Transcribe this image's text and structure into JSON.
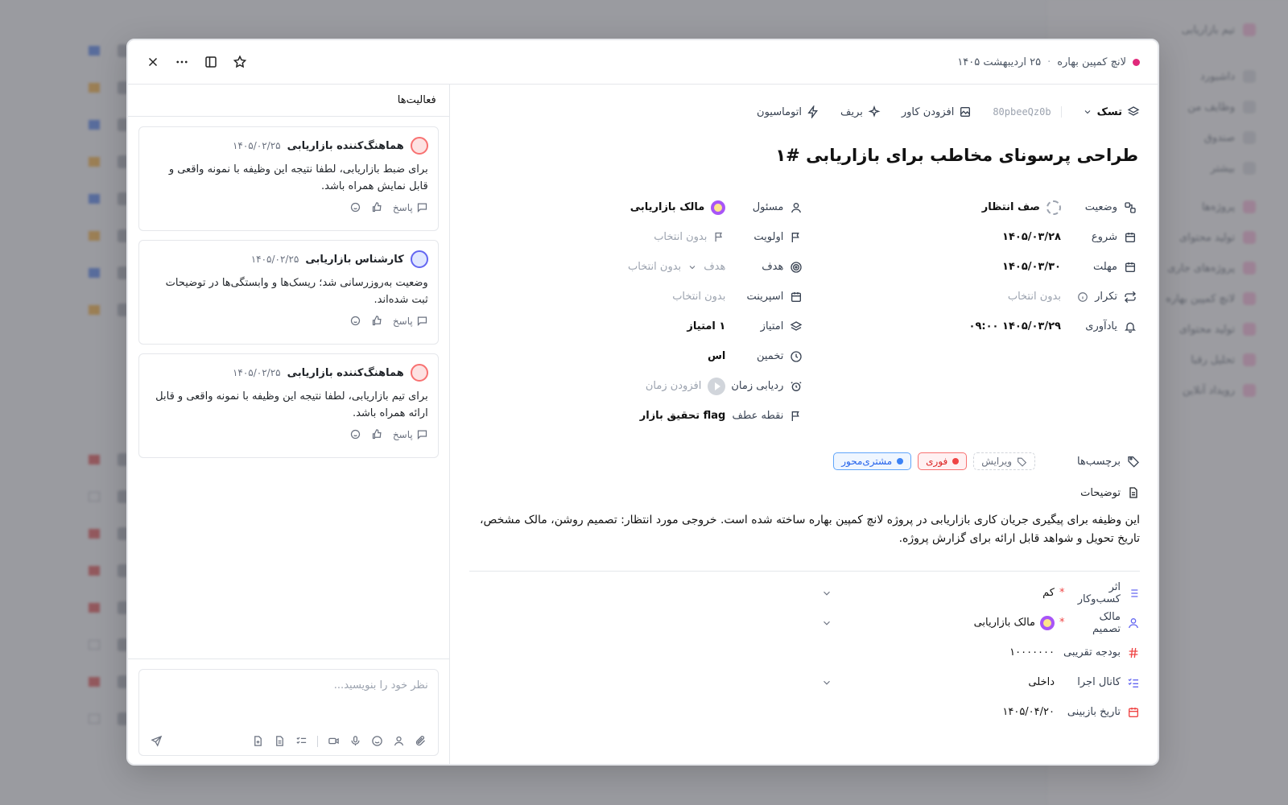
{
  "background": {
    "sidebar_items": [
      "تیم بازاریابی",
      "داشبورد",
      "وظایف من",
      "صندوق",
      "بیشتر",
      "پروژه‌ها",
      "تولید محتوای",
      "پروژه‌های جاری",
      "لانچ کمپین بهاره",
      "تولید محتوای",
      "تحلیل رقبا",
      "رویداد آنلاین"
    ]
  },
  "header": {
    "project": "لانچ کمپین بهاره",
    "date": "۲۵ اردیبهشت ۱۴۰۵"
  },
  "toolbar": {
    "type": "تسک",
    "id": "80pbeeQz0b",
    "add_cover": "افزودن کاور",
    "brief": "بریف",
    "automation": "اتوماسیون"
  },
  "task": {
    "title": "طراحی پرسونای مخاطب برای بازاریابی #۱"
  },
  "properties": {
    "status": {
      "label": "وضعیت",
      "value": "صف انتظار"
    },
    "start": {
      "label": "شروع",
      "value": "۱۴۰۵/۰۳/۲۸"
    },
    "due": {
      "label": "مهلت",
      "value": "۱۴۰۵/۰۳/۳۰"
    },
    "repeat": {
      "label": "تکرار",
      "value": "بدون انتخاب"
    },
    "reminder": {
      "label": "یادآوری",
      "value": "۱۴۰۵/۰۳/۲۹ ۰۹:۰۰"
    },
    "assignee": {
      "label": "مسئول",
      "value": "مالک بازاریابی"
    },
    "priority": {
      "label": "اولویت",
      "value": "بدون انتخاب"
    },
    "goal": {
      "label": "هدف",
      "prefix": "هدف",
      "value": "بدون انتخاب"
    },
    "sprint": {
      "label": "اسپرینت",
      "value": "بدون انتخاب"
    },
    "points": {
      "label": "امتیاز",
      "value": "۱ امتیاز"
    },
    "estimate": {
      "label": "تخمین",
      "value": "اس"
    },
    "time_tracking": {
      "label": "ردیابی زمان",
      "value": "افزودن زمان"
    },
    "milestone": {
      "label": "نقطه عطف",
      "value": "flag تحقیق بازار"
    }
  },
  "tags": {
    "label": "برچسب‌ها",
    "edit": "ویرایش",
    "items": [
      {
        "text": "فوری",
        "color": "#ef4444"
      },
      {
        "text": "مشتری‌محور",
        "color": "#3b82f6"
      }
    ]
  },
  "description": {
    "label": "توضیحات",
    "text": "این وظیفه برای پیگیری جریان کاری بازاریابی در پروژه لانچ کمپین بهاره ساخته شده است. خروجی مورد انتظار: تصمیم روشن، مالک مشخص، تاریخ تحویل و شواهد قابل ارائه برای گزارش پروژه."
  },
  "custom_fields": [
    {
      "label": "اثر کسب‌وکار",
      "value": "کم",
      "required": true,
      "dropdown": true
    },
    {
      "label": "مالک تصمیم",
      "value": "مالک بازاریابی",
      "required": true,
      "dropdown": true
    },
    {
      "label": "بودجه تقریبی",
      "value": "۱۰۰۰۰۰۰۰",
      "required": false,
      "dropdown": false
    },
    {
      "label": "کانال اجرا",
      "value": "داخلی",
      "required": false,
      "dropdown": true
    },
    {
      "label": "تاریخ بازبینی",
      "value": "۱۴۰۵/۰۴/۲۰",
      "required": false,
      "dropdown": false
    }
  ],
  "activity": {
    "title": "فعالیت‌ها",
    "reply_label": "پاسخ",
    "items": [
      {
        "author": "هماهنگ‌کننده بازاریابی",
        "date": "۱۴۰۵/۰۲/۲۵",
        "text": "برای ضبط بازاریابی، لطفا نتیجه این وظیفه با نمونه واقعی و قابل نمایش همراه باشد."
      },
      {
        "author": "کارشناس بازاریابی",
        "date": "۱۴۰۵/۰۲/۲۵",
        "text": "وضعیت به‌روزرسانی شد؛ ریسک‌ها و وابستگی‌ها در توضیحات ثبت شده‌اند."
      },
      {
        "author": "هماهنگ‌کننده بازاریابی",
        "date": "۱۴۰۵/۰۲/۲۵",
        "text": "برای تیم بازاریابی، لطفا نتیجه این وظیفه با نمونه واقعی و قابل ارائه همراه باشد."
      }
    ],
    "composer_placeholder": "نظر خود را بنویسید..."
  },
  "colors": {
    "accent": "#e0287a",
    "red_tag": "#ef4444",
    "blue_tag": "#3b82f6"
  }
}
